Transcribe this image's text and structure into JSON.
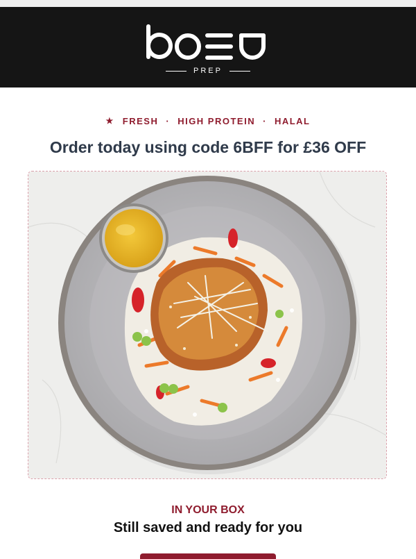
{
  "brand": {
    "logo_text": "bozu",
    "logo_sub": "PREP",
    "colors": {
      "header_bg": "#151515",
      "accent": "#8f1c2e",
      "promo_text": "#2f3a4a"
    }
  },
  "tagline": {
    "icon": "star-icon",
    "items": [
      "FRESH",
      "HIGH PROTEIN",
      "HALAL"
    ],
    "separator": "·"
  },
  "promo": {
    "text": "Order today using code 6BFF for £36 OFF"
  },
  "hero": {
    "image_alt": "Crispy chicken katsu on rice with carrot salad, edamame, red peppers and a pot of curry sauce on a grey plate"
  },
  "box_section": {
    "label": "IN YOUR BOX",
    "subtitle": "Still saved and ready for you"
  }
}
